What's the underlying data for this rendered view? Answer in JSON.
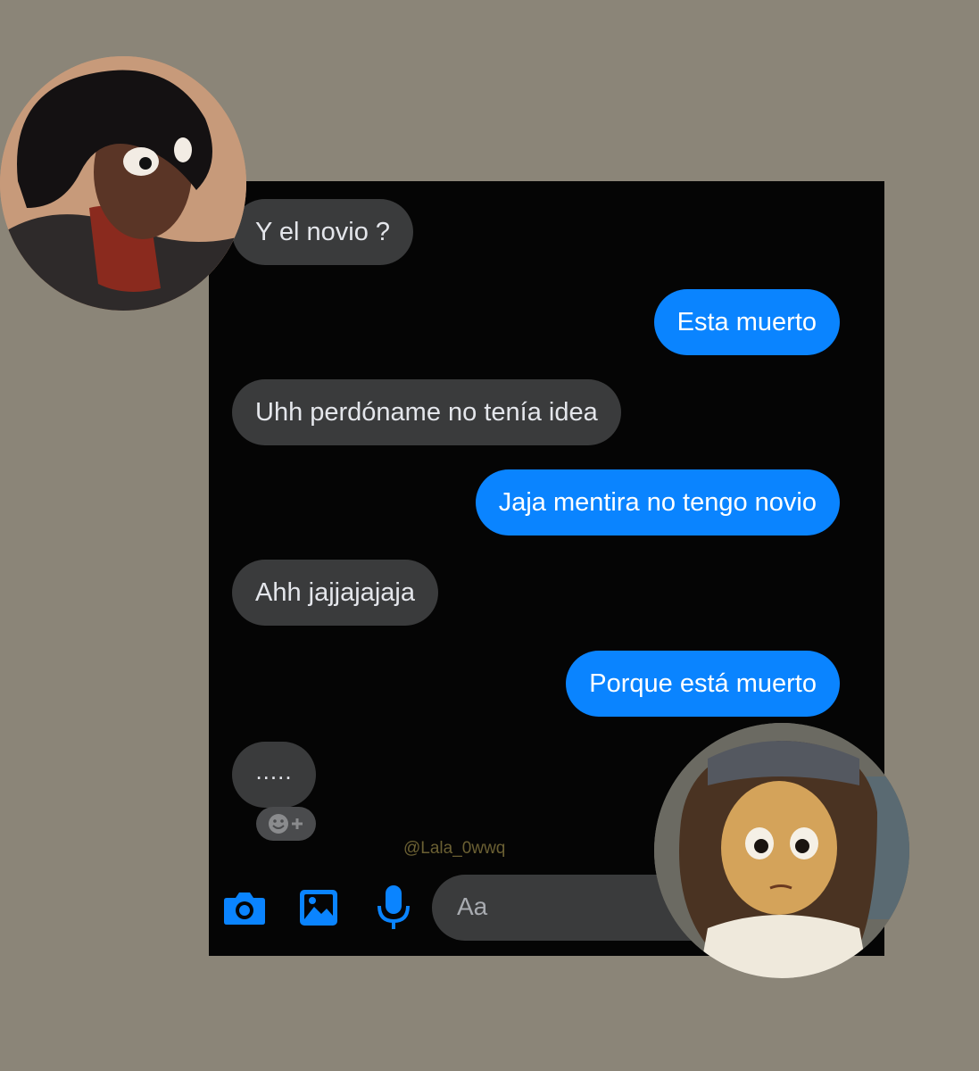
{
  "messages": [
    {
      "text": "Y el novio ?",
      "side": "in"
    },
    {
      "text": "Esta muerto",
      "side": "out"
    },
    {
      "text": "Uhh perdóname no tenía idea",
      "side": "in"
    },
    {
      "text": "Jaja mentira no tengo novio",
      "side": "out"
    },
    {
      "text": "Ahh jajjajajaja",
      "side": "in"
    },
    {
      "text": "Porque está muerto",
      "side": "out"
    }
  ],
  "typing": {
    "text": "....."
  },
  "watermark": "@Lala_0wwq",
  "composer": {
    "placeholder": "Aa"
  },
  "icons": [
    "camera-icon",
    "image-icon",
    "microphone-icon",
    "add-reaction-icon"
  ],
  "colors": {
    "page_background": "#8b8578",
    "chat_background": "#050505",
    "incoming_bubble": "#3a3b3c",
    "outgoing_bubble": "#0a84ff",
    "accent": "#0a84ff"
  }
}
